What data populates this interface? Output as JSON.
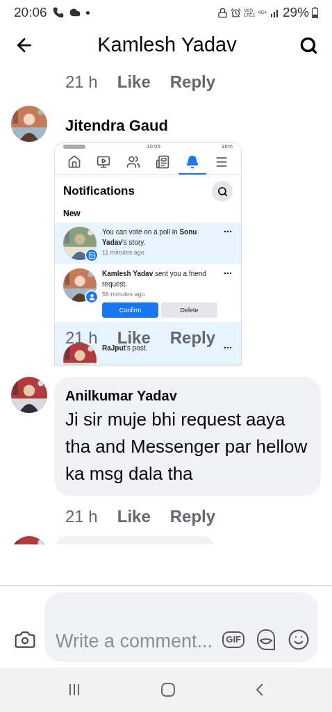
{
  "status_bar": {
    "time": "20:06",
    "network": [
      "Vo))",
      "LTE1",
      "4G+"
    ],
    "battery": "29%"
  },
  "header": {
    "title": "Kamlesh Yadav"
  },
  "top_actions": {
    "time": "21 h",
    "like": "Like",
    "reply": "Reply"
  },
  "comments": [
    {
      "author": "Jitendra Gaud",
      "actions": {
        "time": "21 h",
        "like": "Like",
        "reply": "Reply"
      },
      "screenshot": {
        "time": "10:05",
        "battery": "36%",
        "tabs": [
          {
            "kind": "home",
            "selected": false
          },
          {
            "kind": "video",
            "selected": false
          },
          {
            "kind": "groups",
            "selected": false
          },
          {
            "kind": "news",
            "selected": false
          },
          {
            "kind": "bell",
            "selected": true
          },
          {
            "kind": "menu",
            "selected": false
          }
        ],
        "title": "Notifications",
        "section": "New",
        "notifications": [
          {
            "unread": true,
            "text": "You can vote on a poll in **Sonu Yadav**'s story.",
            "time": "11 minutes ago"
          },
          {
            "kind": "person",
            "unread": false,
            "text": "**Kamlesh Yadav** sent you a friend request.",
            "time": "58 minutes ago",
            "buttons": [
              "Confirm",
              "Delete"
            ]
          },
          {
            "unread": true,
            "text": "**RaJput**'s post."
          }
        ]
      }
    },
    {
      "kind": "text",
      "author": "Anilkumar Yadav",
      "text": "Ji sir muje bhi request aaya tha and Messenger par hellow ka msg dala tha",
      "actions": {
        "time": "21 h",
        "like": "Like",
        "reply": "Reply"
      }
    }
  ],
  "composer": {
    "placeholder": "Write a comment...",
    "gif": "GIF"
  }
}
